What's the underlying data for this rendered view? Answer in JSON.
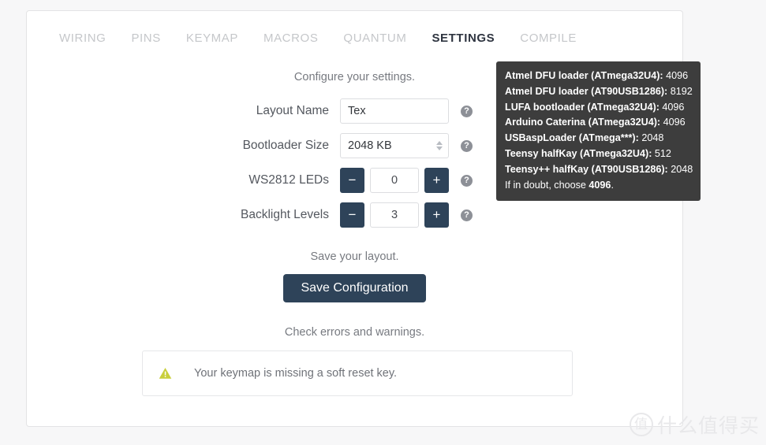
{
  "tabs": [
    {
      "label": "WIRING",
      "active": false
    },
    {
      "label": "PINS",
      "active": false
    },
    {
      "label": "KEYMAP",
      "active": false
    },
    {
      "label": "MACROS",
      "active": false
    },
    {
      "label": "QUANTUM",
      "active": false
    },
    {
      "label": "SETTINGS",
      "active": true
    },
    {
      "label": "COMPILE",
      "active": false
    }
  ],
  "settings": {
    "configure_note": "Configure your settings.",
    "layout_name": {
      "label": "Layout Name",
      "value": "Tex",
      "placeholder": "Layout Name",
      "help": "?"
    },
    "bootloader_size": {
      "label": "Bootloader Size",
      "value": "2048 KB",
      "help": "?"
    },
    "ws2812_leds": {
      "label": "WS2812 LEDs",
      "value": "0",
      "minus": "−",
      "plus": "+",
      "help": "?"
    },
    "backlight_levels": {
      "label": "Backlight Levels",
      "value": "3",
      "minus": "−",
      "plus": "+",
      "help": "?"
    }
  },
  "save": {
    "note": "Save your layout.",
    "button_label": "Save Configuration"
  },
  "errors": {
    "note": "Check errors and warnings.",
    "warning_text": "Your keymap is missing a soft reset key."
  },
  "tooltip": {
    "lines": [
      {
        "name": "Atmel DFU loader (ATmega32U4):",
        "value": "4096"
      },
      {
        "name": "Atmel DFU loader (AT90USB1286):",
        "value": "8192"
      },
      {
        "name": "LUFA bootloader (ATmega32U4):",
        "value": "4096"
      },
      {
        "name": "Arduino Caterina (ATmega32U4):",
        "value": "4096"
      },
      {
        "name": "USBaspLoader (ATmega***):",
        "value": "2048"
      },
      {
        "name": "Teensy halfKay (ATmega32U4):",
        "value": "512"
      },
      {
        "name": "Teensy++ halfKay (AT90USB1286):",
        "value": "2048"
      }
    ],
    "footer_prefix": "If in doubt, choose ",
    "footer_bold": "4096",
    "footer_suffix": "."
  },
  "watermark": {
    "badge": "值",
    "text": "什么值得买"
  },
  "colors": {
    "accent_dark": "#2e4359",
    "tooltip_bg": "#3d3d3d",
    "warning": "#c9cf3c",
    "page_bg": "#f7f7f8",
    "card_bg": "#ffffff"
  }
}
